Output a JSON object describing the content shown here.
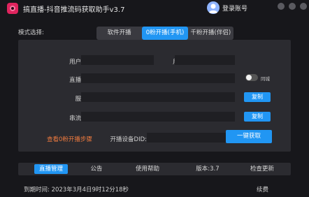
{
  "app": {
    "title": "搞直播-抖音推流码获取助手v3.7",
    "login_label": "登录账号",
    "accent_color": "#2196f3",
    "link_color": "#f07b3f",
    "logo_icon": "app-logo-icon",
    "avatar_icon": "user-avatar-icon"
  },
  "mode": {
    "label": "模式选择:",
    "tabs": [
      {
        "label": "软件开播",
        "active": false
      },
      {
        "label": "0粉开播(手机)",
        "active": true
      },
      {
        "label": "千粉开播(伴侣)",
        "active": false
      }
    ]
  },
  "form": {
    "nickname_label": "用户昵称:",
    "nickname_value": "",
    "userid_label": "用户ID:",
    "userid_value": "",
    "stream_title_label": "直播标题:",
    "stream_title_value": "",
    "sync_label": "同城",
    "sync_on": false,
    "server_label": "服务器:",
    "server_value": "",
    "stream_key_label": "串流密匙:",
    "stream_key_value": "",
    "copy_label": "复制",
    "tutorial_link": "查看0粉开播步骤",
    "device_did_label": "开播设备DID:",
    "device_did_value": "",
    "get_button": "一键获取"
  },
  "bottom_nav": {
    "items": [
      {
        "label": "直播管理",
        "active": true,
        "clickable": true
      },
      {
        "label": "公告",
        "active": false,
        "clickable": true
      },
      {
        "label": "使用帮助",
        "active": false,
        "clickable": true
      },
      {
        "label": "版本:3.7",
        "active": false,
        "clickable": false
      },
      {
        "label": "检查更新",
        "active": false,
        "clickable": true
      }
    ]
  },
  "footer": {
    "expire_text": "到期时间: 2023年3月4日9时12分18秒",
    "renew_label": "续费"
  }
}
